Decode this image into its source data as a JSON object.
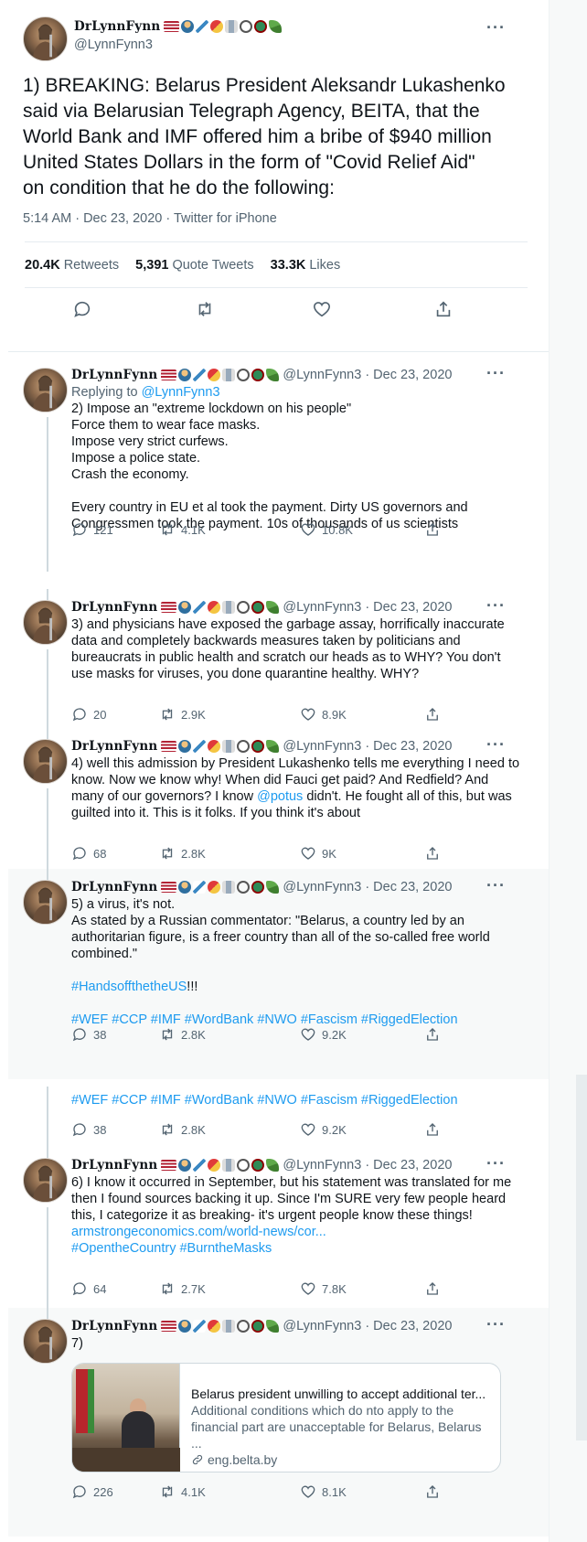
{
  "author": {
    "display_name": "DrLynnFynn",
    "handle": "@LynnFynn3"
  },
  "main_tweet": {
    "text_lines": [
      "1) BREAKING: Belarus President Aleksandr Lukashenko",
      "said via Belarusian Telegraph Agency, BEITA, that the",
      "World Bank and IMF offered him a bribe of $940 million",
      "United States Dollars in the form of \"Covid Relief Aid\"",
      "on condition that he do the following:"
    ],
    "timestamp": "5:14 AM · Dec 23, 2020 · Twitter for iPhone",
    "retweets_count": "20.4K",
    "retweets_label": "Retweets",
    "quotes_count": "5,391",
    "quotes_label": "Quote Tweets",
    "likes_count": "33.3K",
    "likes_label": "Likes"
  },
  "tweet_meta": "@LynnFynn3 · Dec 23, 2020",
  "tweets": [
    {
      "replying_label": "Replying to",
      "replying_handle": "@LynnFynn3",
      "lines": [
        "2) Impose an \"extreme lockdown on his people\"",
        "Force them to wear face masks.",
        "Impose very strict curfews.",
        "Impose a police state.",
        "Crash the economy.",
        "",
        "Every country in EU et al took the payment. Dirty US governors and",
        "Congressmen took the payment. 10s of thousands of us scientists"
      ],
      "replies": "121",
      "retweets": "4.1K",
      "likes": "10.8K"
    },
    {
      "lines": [
        "3) and physicians have exposed the garbage assay, horrifically inaccurate",
        "data and completely backwards measures taken by politicians and",
        "bureaucrats in public health and scratch our heads as to WHY? You don't",
        "use masks for viruses, you done quarantine healthy. WHY?"
      ],
      "replies": "20",
      "retweets": "2.9K",
      "likes": "8.9K"
    },
    {
      "line1": "4) well this admission by President Lukashenko tells me everything I need to",
      "line2": "know. Now we know why! When did Fauci get paid? And Redfield? And",
      "line3_pre": "many of our governors? I know ",
      "line3_link": "@potus",
      "line3_post": " didn't. He fought all of this, but was",
      "line4": "guilted into it. This is it folks. If you think it's about",
      "replies": "68",
      "retweets": "2.8K",
      "likes": "9K"
    },
    {
      "lines": [
        "5) a virus, it's not.",
        "As stated by a Russian commentator: \"Belarus, a country led by an",
        "authoritarian figure, is a freer country than all of the so-called free world",
        "combined.\""
      ],
      "hashtag_line1_link": "#HandsoffthetheUS",
      "hashtag_line1_post": "!!!",
      "hashtag_line2": "#WEF #CCP #IMF #WordBank #NWO #Fascism #RiggedElection",
      "replies": "38",
      "retweets": "2.8K",
      "likes": "9.2K"
    },
    {
      "hashtag_line": "#WEF #CCP #IMF #WordBank #NWO #Fascism #RiggedElection",
      "replies": "38",
      "retweets": "2.8K",
      "likes": "9.2K"
    },
    {
      "lines": [
        "6) I know it occurred in September, but his statement was translated for me",
        "then I found sources backing it up. Since I'm SURE very few people heard",
        "this, I categorize it as breaking- it's urgent people know these things!"
      ],
      "link_line": "armstrongeconomics.com/world-news/cor...",
      "hashtags": "#OpentheCountry #BurntheMasks",
      "replies": "64",
      "retweets": "2.7K",
      "likes": "7.8K"
    },
    {
      "lines": [
        "7)"
      ],
      "card": {
        "title": "Belarus president unwilling to accept additional ter...",
        "desc_line1": "Additional conditions which do nto apply to the",
        "desc_line2": "financial part are unacceptable for Belarus, Belarus ...",
        "domain": "eng.belta.by"
      },
      "replies": "226",
      "retweets": "4.1K",
      "likes": "8.1K"
    }
  ],
  "icons": [
    "reply-icon",
    "retweet-icon",
    "like-icon",
    "share-icon",
    "more-icon",
    "link-icon"
  ],
  "colors": {
    "link": "#1d9bf0",
    "secondary": "#536471",
    "highlight_bg": "#f7f9f9"
  }
}
